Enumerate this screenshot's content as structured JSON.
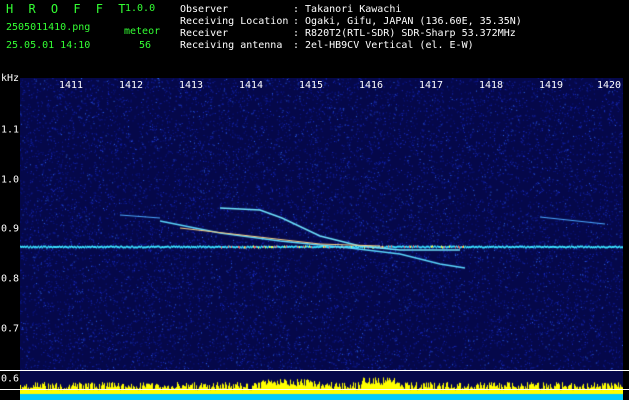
{
  "app": {
    "name": "H R O F F T",
    "version": "1.0.0"
  },
  "file": {
    "name": "2505011410.png",
    "datetime": "25.05.01 14:10"
  },
  "detection": {
    "label": "meteor",
    "count": "56"
  },
  "info": {
    "observer_label": "Observer",
    "observer_value": ": Takanori Kawachi",
    "location_label": "Receiving Location",
    "location_value": ": Ogaki, Gifu, JAPAN (136.60E, 35.35N)",
    "receiver_label": "Receiver",
    "receiver_value": ": R820T2(RTL-SDR) SDR-Sharp 53.372MHz",
    "antenna_label": "Receiving antenna",
    "antenna_value": ": 2el-HB9CV Vertical (el. E-W)"
  },
  "axes": {
    "y_unit": "kHz",
    "x_ticks": [
      "1411",
      "1412",
      "1413",
      "1414",
      "1415",
      "1416",
      "1417",
      "1418",
      "1419",
      "1420"
    ],
    "y_ticks": [
      "1.1",
      "1.0",
      "0.9",
      "0.8",
      "0.7",
      "0.6"
    ]
  },
  "colors": {
    "background": "#05084a",
    "noise": "#1a2fd0",
    "signal_cyan": "#39e0ff",
    "signal_yellow": "#ffff40",
    "level_bar": "#ffff00",
    "level_base": "#00ccff",
    "header_green": "#33ff33"
  }
}
